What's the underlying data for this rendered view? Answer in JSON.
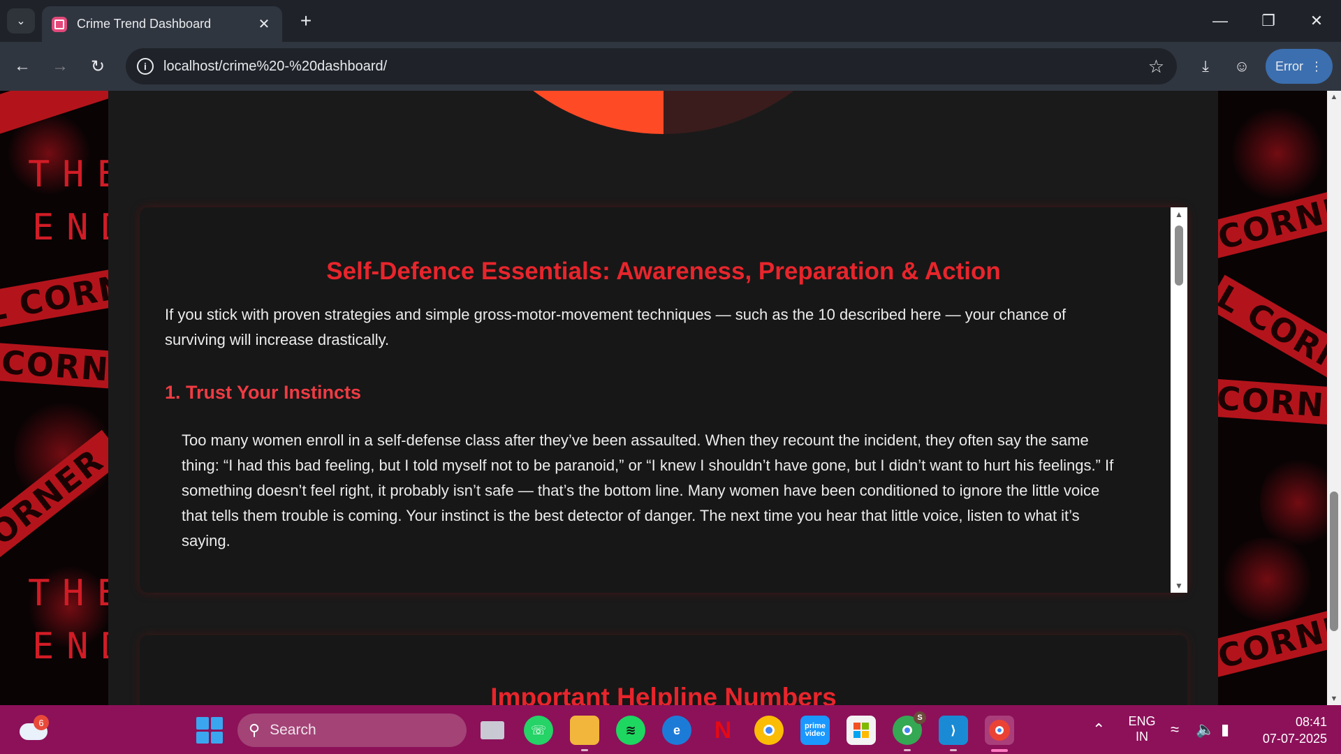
{
  "browser": {
    "tab_title": "Crime Trend Dashboard",
    "url": "localhost/crime%20-%20dashboard/",
    "profile_button": "Error"
  },
  "background": {
    "tape_text": "CORNER",
    "tape_text_alt": "L CORNE",
    "end_text_line1": "THE",
    "end_text_line2": "END",
    "accent": "#b3141b"
  },
  "pie": {
    "colors": [
      "#c81a0b",
      "#ff4a26",
      "#3a1c1c",
      "#ffaca3"
    ]
  },
  "article": {
    "title": "Self-Defence Essentials: Awareness, Preparation & Action",
    "intro": "If you stick with proven strategies and simple gross-motor-movement techniques — such as the 10 described here — your chance of surviving will increase drastically.",
    "section_heading": "1. Trust Your Instincts",
    "section_body": "Too many women enroll in a self-defense class after they’ve been assaulted. When they recount the incident, they often say the same thing: “I had this bad feeling, but I told myself not to be paranoid,” or “I knew I shouldn’t have gone, but I didn’t want to hurt his feelings.” If something doesn’t feel right, it probably isn’t safe — that’s the bottom line. Many women have been conditioned to ignore the little voice that tells them trouble is coming. Your instinct is the best detector of danger. The next time you hear that little voice, listen to what it’s saying.",
    "title_color": "#e8252c"
  },
  "helpline": {
    "title": "Important Helpline Numbers"
  },
  "taskbar": {
    "weather_badge": "6",
    "search_placeholder": "Search",
    "chrome_badge": "S",
    "lang_line1": "ENG",
    "lang_line2": "IN",
    "time": "08:41",
    "date": "07-07-2025",
    "color": "#8c1159"
  }
}
